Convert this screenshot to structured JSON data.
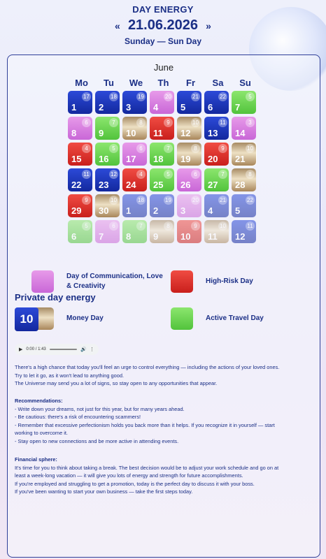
{
  "header": {
    "title": "DAY ENERGY",
    "prev_icon": "«",
    "date": "21.06.2026",
    "next_icon": "»",
    "weekday": "Sunday — Sun Day"
  },
  "calendar": {
    "month": "June",
    "weekdays": [
      "Mo",
      "Tu",
      "We",
      "Th",
      "Fr",
      "Sa",
      "Su"
    ],
    "cells": [
      {
        "day": "1",
        "ev": "17",
        "type": "t-blue"
      },
      {
        "day": "2",
        "ev": "18",
        "type": "t-blue"
      },
      {
        "day": "3",
        "ev": "19",
        "type": "t-blue"
      },
      {
        "day": "4",
        "ev": "20",
        "type": "t-pink"
      },
      {
        "day": "5",
        "ev": "21",
        "type": "t-blue"
      },
      {
        "day": "6",
        "ev": "22",
        "type": "t-blue"
      },
      {
        "day": "7",
        "ev": "5",
        "type": "t-green"
      },
      {
        "day": "8",
        "ev": "6",
        "type": "t-pink"
      },
      {
        "day": "9",
        "ev": "7",
        "type": "t-green"
      },
      {
        "day": "10",
        "ev": "8",
        "type": "t-gold"
      },
      {
        "day": "11",
        "ev": "9",
        "type": "t-red"
      },
      {
        "day": "12",
        "ev": "10",
        "type": "t-gold"
      },
      {
        "day": "13",
        "ev": "11",
        "type": "t-blue"
      },
      {
        "day": "14",
        "ev": "3",
        "type": "t-pink"
      },
      {
        "day": "15",
        "ev": "4",
        "type": "t-red"
      },
      {
        "day": "16",
        "ev": "5",
        "type": "t-green"
      },
      {
        "day": "17",
        "ev": "6",
        "type": "t-pink"
      },
      {
        "day": "18",
        "ev": "7",
        "type": "t-green"
      },
      {
        "day": "19",
        "ev": "8",
        "type": "t-gold"
      },
      {
        "day": "20",
        "ev": "9",
        "type": "t-red"
      },
      {
        "day": "21",
        "ev": "10",
        "type": "t-gold"
      },
      {
        "day": "22",
        "ev": "11",
        "type": "t-blue"
      },
      {
        "day": "23",
        "ev": "12",
        "type": "t-blue"
      },
      {
        "day": "24",
        "ev": "4",
        "type": "t-red"
      },
      {
        "day": "25",
        "ev": "5",
        "type": "t-green"
      },
      {
        "day": "26",
        "ev": "6",
        "type": "t-pink"
      },
      {
        "day": "27",
        "ev": "7",
        "type": "t-green"
      },
      {
        "day": "28",
        "ev": "8",
        "type": "t-gold"
      },
      {
        "day": "29",
        "ev": "9",
        "type": "t-red"
      },
      {
        "day": "30",
        "ev": "10",
        "type": "t-gold"
      },
      {
        "day": "1",
        "ev": "18",
        "type": "t-blue",
        "faded": true
      },
      {
        "day": "2",
        "ev": "19",
        "type": "t-blue",
        "faded": true
      },
      {
        "day": "3",
        "ev": "20",
        "type": "t-pink",
        "faded": true
      },
      {
        "day": "4",
        "ev": "21",
        "type": "t-blue",
        "faded": true
      },
      {
        "day": "5",
        "ev": "22",
        "type": "t-blue",
        "faded": true
      },
      {
        "day": "6",
        "ev": "5",
        "type": "t-green",
        "faded": true
      },
      {
        "day": "7",
        "ev": "6",
        "type": "t-pink",
        "faded": true
      },
      {
        "day": "8",
        "ev": "7",
        "type": "t-green",
        "faded": true
      },
      {
        "day": "9",
        "ev": "8",
        "type": "t-gold",
        "faded": true
      },
      {
        "day": "10",
        "ev": "9",
        "type": "t-red",
        "faded": true
      },
      {
        "day": "11",
        "ev": "10",
        "type": "t-gold",
        "faded": true
      },
      {
        "day": "12",
        "ev": "11",
        "type": "t-blue",
        "faded": true
      }
    ],
    "today_index": 20
  },
  "legend": {
    "communication": "Day of Communication, Love & Creativity",
    "high_risk": "High-Risk Day",
    "money": "Money Day",
    "travel": "Active Travel Day"
  },
  "private": {
    "title": "Private day energy",
    "value": "10"
  },
  "audio": {
    "play_icon": "▶",
    "time": "0:00 / 1:43",
    "volume_icon": "🔊",
    "more_icon": "⋮"
  },
  "text": {
    "p1": [
      "There's a high chance that today you'll feel an urge to control everything — including the actions of your loved ones.",
      "Try to let it go, as it won't lead to anything good.",
      "The Universe may send you a lot of signs, so stay open to any opportunities that appear."
    ],
    "rec_title": "Recommendations:",
    "rec": [
      "- Write down your dreams, not just for this year, but for many years ahead.",
      "- Be cautious: there's a risk of encountering scammers!",
      "- Remember that excessive perfectionism holds you back more than it helps. If you recognize it in yourself — start",
      "working to overcome it.",
      "- Stay open to new connections and be more active in attending events."
    ],
    "fin_title": "Financial sphere:",
    "fin": [
      "It's time for you to think about taking a break. The best decision would be to adjust your work schedule and go on at",
      "least a week-long vacation — it will give you lots of energy and strength for future accomplishments.",
      "If you're employed and struggling to get a promotion, today is the perfect day to discuss it with your boss.",
      "If you've been wanting to start your own business — take the first steps today."
    ]
  }
}
